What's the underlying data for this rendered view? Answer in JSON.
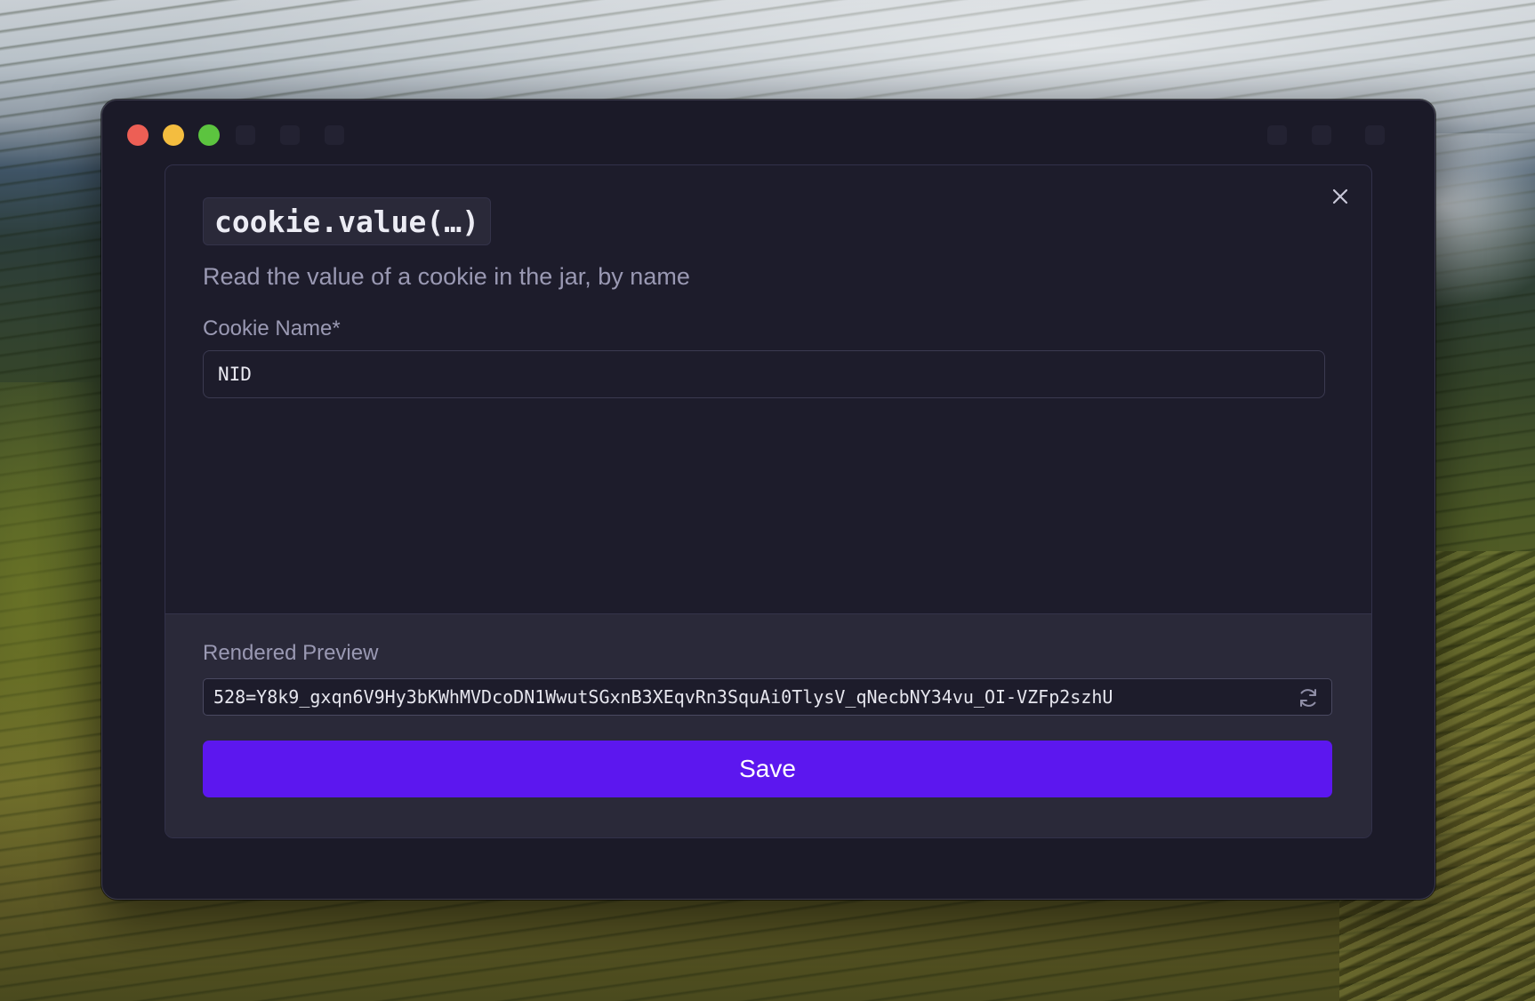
{
  "dialog": {
    "function_name": "cookie.value(…)",
    "description": "Read the value of a cookie in the jar, by name",
    "close_icon": "close-icon"
  },
  "form": {
    "cookie_name_label": "Cookie Name",
    "required_marker": "*",
    "cookie_name_value": "NID"
  },
  "preview": {
    "label": "Rendered Preview",
    "value": "528=Y8k9_gxqn6V9Hy3bKWhMVDcoDN1WwutSGxnB3XEqvRn3SquAi0TlysV_qNecbNY34vu_OI-VZFp2szhU",
    "refresh_icon": "refresh-icon"
  },
  "actions": {
    "save_label": "Save"
  },
  "colors": {
    "accent": "#5c17ef",
    "window_bg": "#1b1a28",
    "dialog_bg": "#1d1c2b",
    "footer_bg": "#2a2939",
    "traffic_close": "#ed5f55",
    "traffic_minimize": "#f4bd3f",
    "traffic_maximize": "#5cc43f"
  }
}
